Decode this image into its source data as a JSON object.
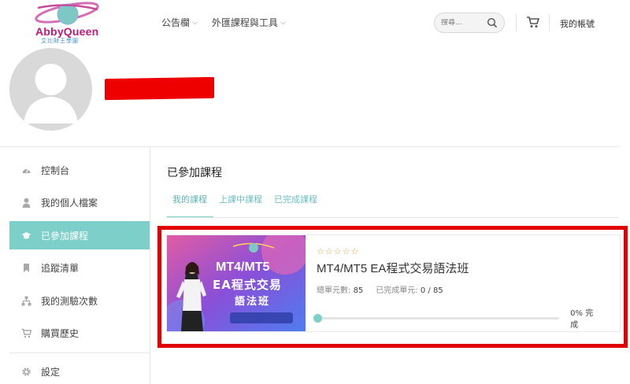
{
  "brand": {
    "name": "AbbyQueen",
    "subtitle": "艾比財王學園"
  },
  "nav": {
    "items": [
      {
        "label": "公告欄"
      },
      {
        "label": "外匯課程與工具"
      }
    ]
  },
  "search": {
    "placeholder": "搜尋..."
  },
  "header": {
    "account_label": "我的帳號"
  },
  "sidebar": {
    "items": [
      {
        "label": "控制台",
        "icon": "dashboard-icon"
      },
      {
        "label": "我的個人檔案",
        "icon": "user-icon"
      },
      {
        "label": "已參加課程",
        "icon": "graduation-cap-icon",
        "active": true
      },
      {
        "label": "追蹤清單",
        "icon": "bookmark-icon"
      },
      {
        "label": "我的測驗次數",
        "icon": "sitemap-icon"
      },
      {
        "label": "購買歷史",
        "icon": "cart-icon"
      },
      {
        "label": "設定",
        "icon": "gear-icon"
      }
    ]
  },
  "main": {
    "title": "已參加課程",
    "tabs": [
      {
        "label": "我的課程",
        "active": true
      },
      {
        "label": "上課中課程"
      },
      {
        "label": "已完成課程"
      }
    ]
  },
  "course": {
    "title": "MT4/MT5 EA程式交易語法班",
    "rating_stars": 0,
    "total_units_label": "總單元數:",
    "total_units": "85",
    "completed_units_label": "已完成單元:",
    "completed_units": "0 / 85",
    "progress_percent": 0,
    "progress_label": "0% 完成",
    "thumbnail": {
      "line1": "MT4/MT5",
      "line2": "EA程式交易",
      "line3": "語法班"
    }
  },
  "colors": {
    "accent": "#7dcfca",
    "highlight": "#e00000",
    "star": "#e8a33c"
  }
}
